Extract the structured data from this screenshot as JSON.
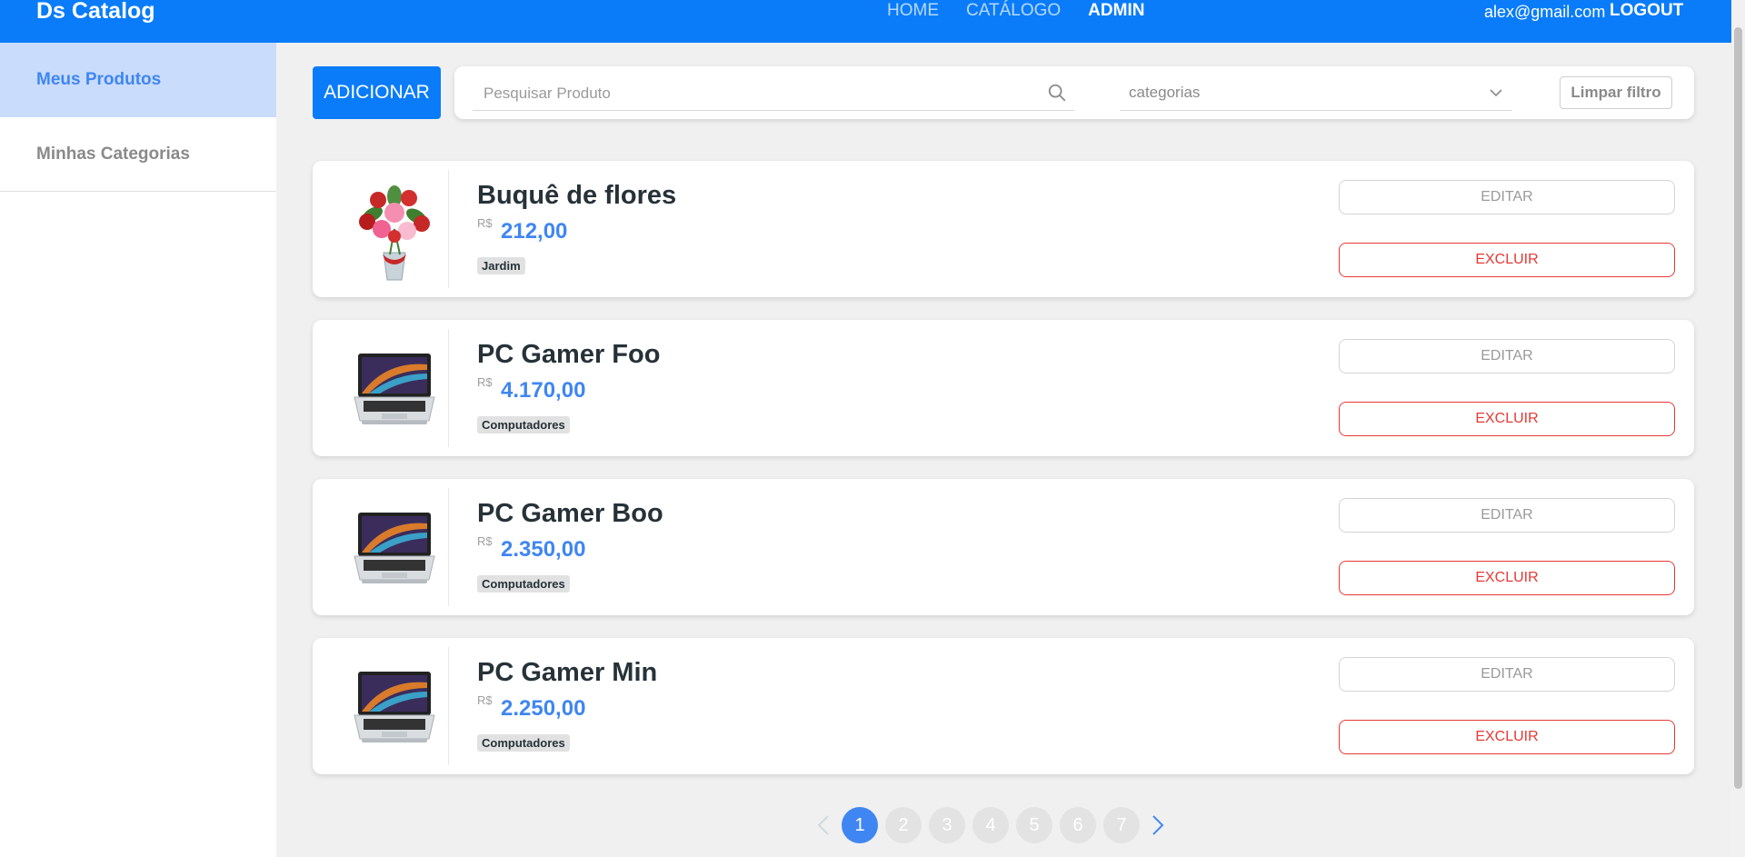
{
  "navbar": {
    "brand": "Ds Catalog",
    "links": [
      "HOME",
      "CATÁLOGO",
      "ADMIN"
    ],
    "active_link": "ADMIN",
    "user_email": "alex@gmail.com",
    "logout_label": "LOGOUT"
  },
  "sidebar": {
    "items": [
      {
        "label": "Meus Produtos",
        "active": true
      },
      {
        "label": "Minhas Categorias",
        "active": false
      }
    ]
  },
  "toolbar": {
    "add_label": "ADICIONAR",
    "search_placeholder": "Pesquisar Produto",
    "category_placeholder": "categorias",
    "clear_label": "Limpar filtro"
  },
  "products": [
    {
      "name": "Buquê de flores",
      "currency": "R$",
      "price": "212,00",
      "category": "Jardim",
      "image": "flower-bouquet-image"
    },
    {
      "name": "PC Gamer Foo",
      "currency": "R$",
      "price": "4.170,00",
      "category": "Computadores",
      "image": "laptop-image"
    },
    {
      "name": "PC Gamer Boo",
      "currency": "R$",
      "price": "2.350,00",
      "category": "Computadores",
      "image": "laptop-image"
    },
    {
      "name": "PC Gamer Min",
      "currency": "R$",
      "price": "2.250,00",
      "category": "Computadores",
      "image": "laptop-image"
    }
  ],
  "card_actions": {
    "edit_label": "EDITAR",
    "delete_label": "EXCLUIR"
  },
  "pagination": {
    "pages": [
      "1",
      "2",
      "3",
      "4",
      "5",
      "6",
      "7"
    ],
    "current": "1"
  },
  "colors": {
    "primary": "#0a7cfa",
    "accent_blue": "#3f86f2",
    "danger": "#e53935",
    "sidebar_active_bg": "#c9dcfc"
  }
}
